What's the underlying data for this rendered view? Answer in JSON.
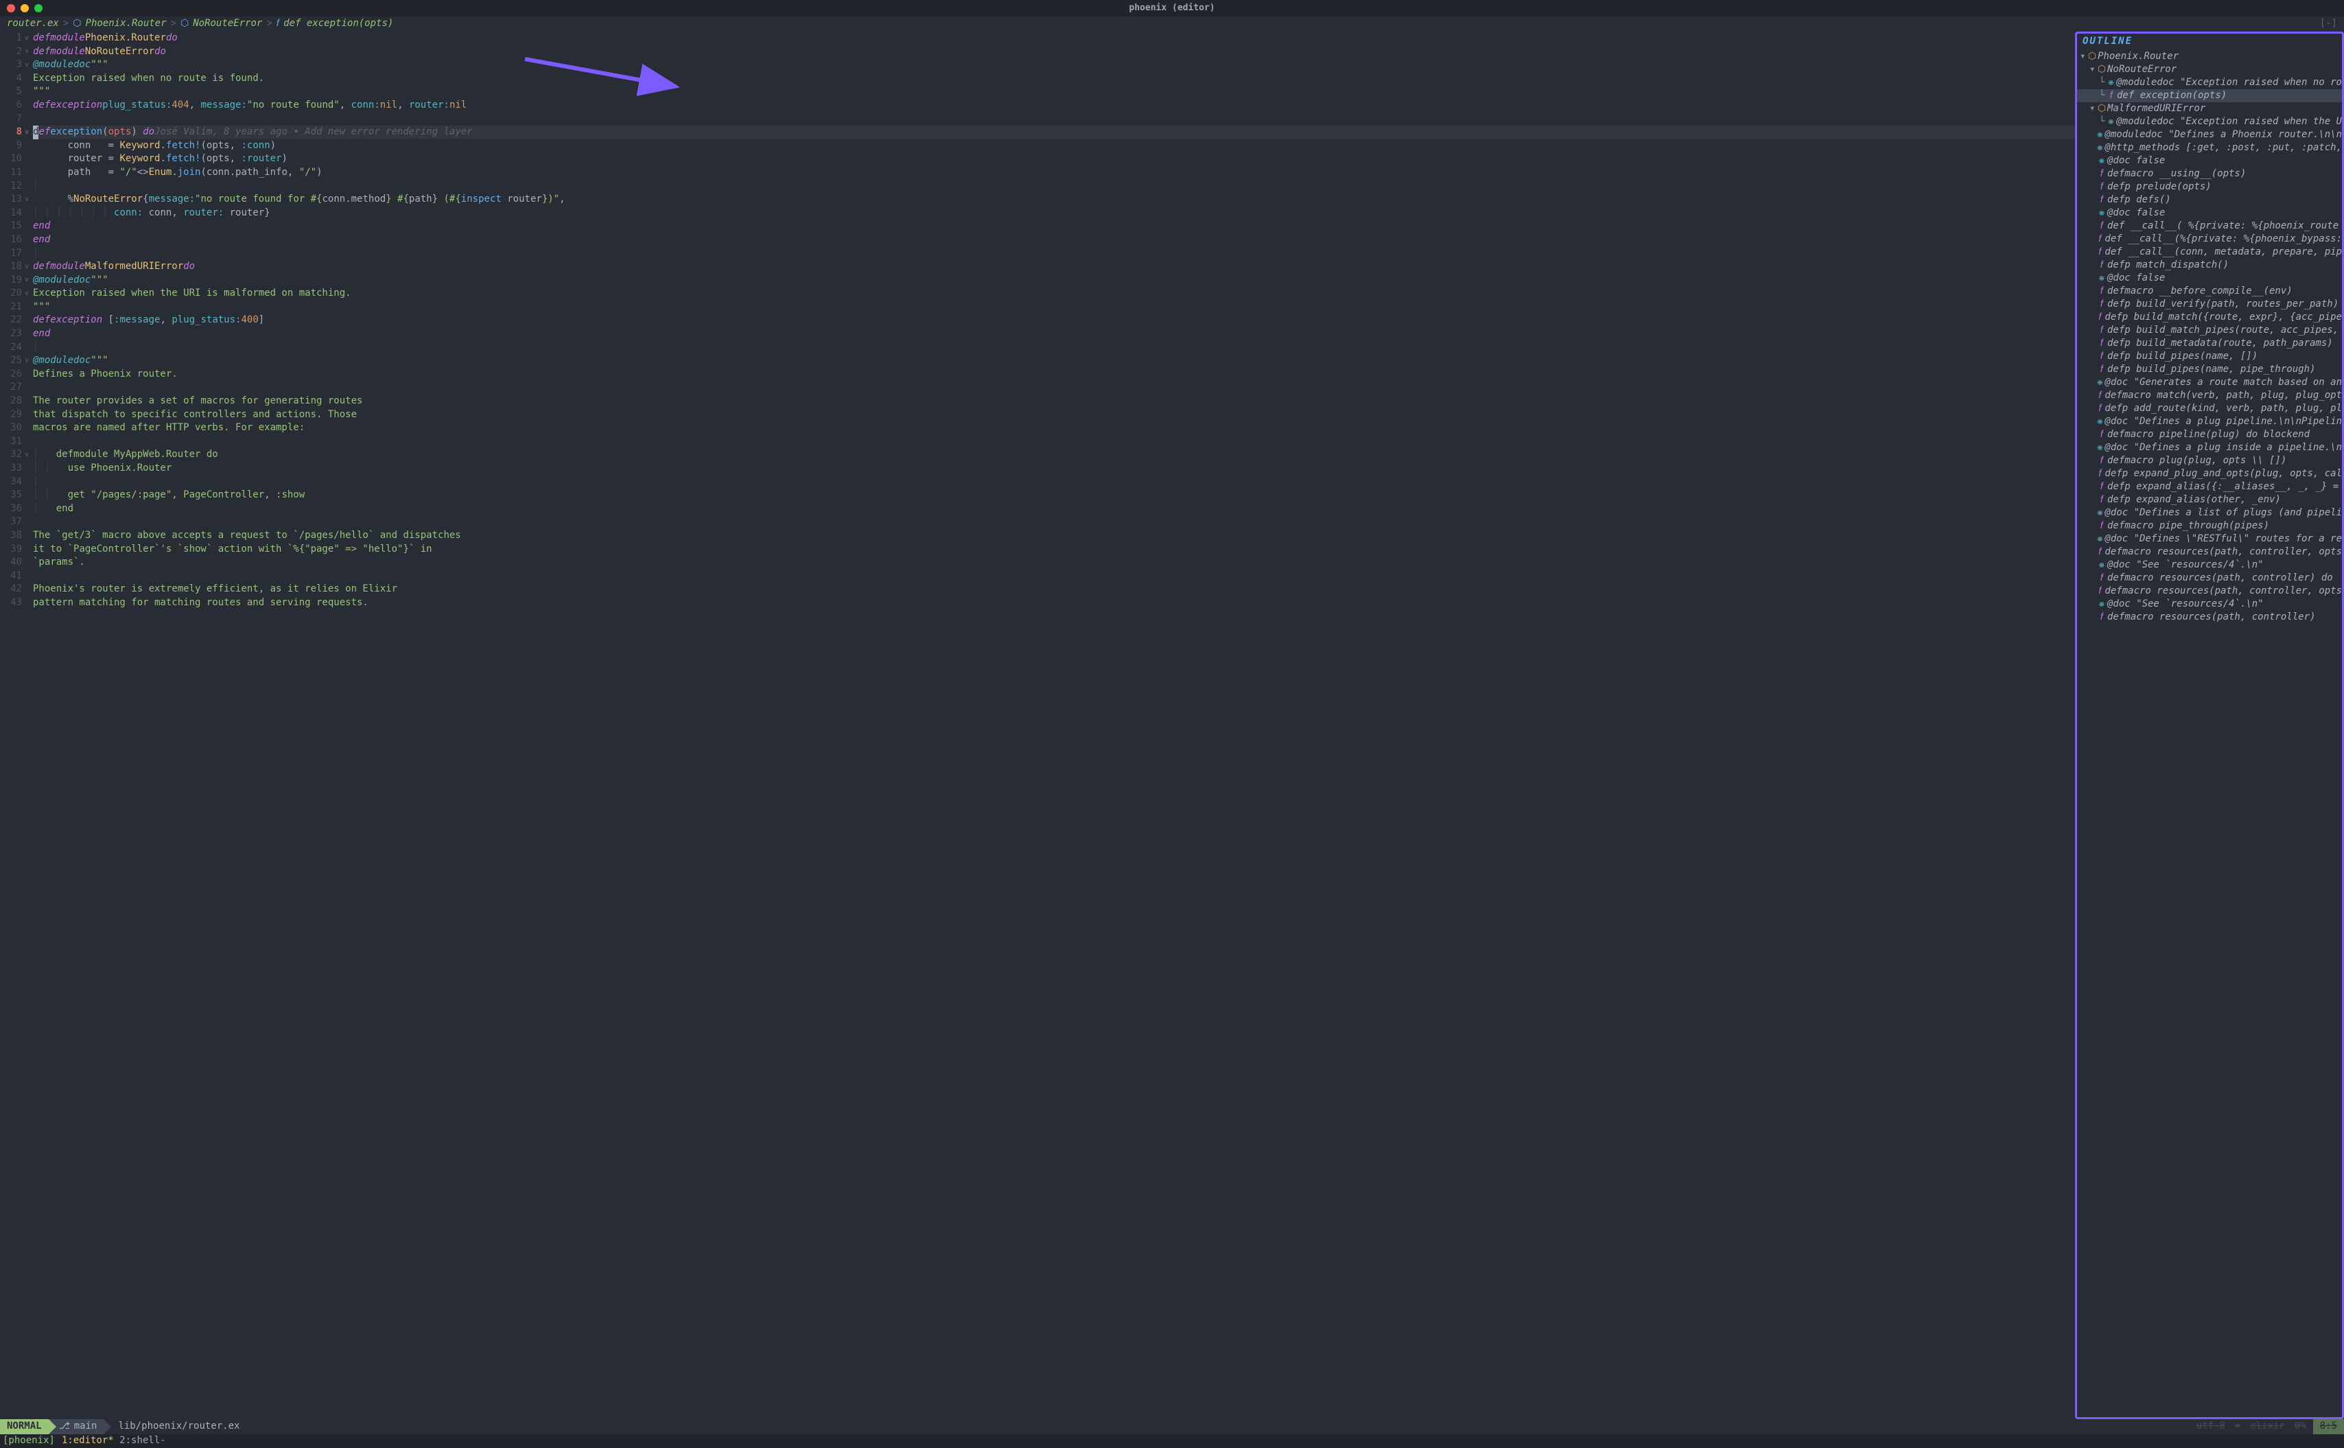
{
  "title": "phoenix (editor)",
  "breadcrumb": {
    "file": "router.ex",
    "segments": [
      {
        "icon": "⬡",
        "label": "Phoenix.Router"
      },
      {
        "icon": "⬡",
        "label": "NoRouteError"
      },
      {
        "icon": "𝑓",
        "label": "def exception(opts)"
      }
    ],
    "toggle": "[-]"
  },
  "editor": {
    "current_line": 8,
    "lines": [
      {
        "n": 1,
        "fold": "v",
        "html": "<span class='kw'>defmodule</span> <span class='mod'>Phoenix.Router</span> <span class='kw2'>do</span>"
      },
      {
        "n": 2,
        "fold": "v",
        "html": "  <span class='kw'>defmodule</span> <span class='mod'>NoRouteError</span> <span class='kw2'>do</span>"
      },
      {
        "n": 3,
        "fold": "v",
        "html": "    <span class='attr'>@moduledoc</span> <span class='str'>\"\"\"</span>"
      },
      {
        "n": 4,
        "fold": "",
        "html": "    <span class='str'>Exception raised when no route is found.</span>"
      },
      {
        "n": 5,
        "fold": "",
        "html": "    <span class='str'>\"\"\"</span>"
      },
      {
        "n": 6,
        "fold": "",
        "html": "    <span class='kw'>defexception</span> <span class='atom'>plug_status:</span> <span class='num'>404</span>, <span class='atom'>message:</span> <span class='str'>\"no route found\"</span>, <span class='atom'>conn:</span> <span class='num'>nil</span>, <span class='atom'>router:</span> <span class='num'>nil</span>"
      },
      {
        "n": 7,
        "fold": "",
        "html": ""
      },
      {
        "n": 8,
        "fold": "v",
        "html": "    <span class='cursor-box'>d</span><span class='kw' style='font-style:italic'>ef</span> <span class='fn'>exception</span>(<span class='param'>opts</span>) <span class='kw2'>do</span>    <span class='blame'>José Valim, 8 years ago • Add new error rendering layer</span>",
        "current": true
      },
      {
        "n": 9,
        "fold": "",
        "html": "      conn   = <span class='mod'>Keyword</span>.<span class='fn'>fetch!</span>(opts, <span class='atom'>:conn</span>)"
      },
      {
        "n": 10,
        "fold": "",
        "html": "      router = <span class='mod'>Keyword</span>.<span class='fn'>fetch!</span>(opts, <span class='atom'>:router</span>)"
      },
      {
        "n": 11,
        "fold": "",
        "html": "      path   = <span class='str'>\"/\"</span> <span class='op'>&lt;&gt;</span> <span class='mod'>Enum</span>.<span class='fn'>join</span>(conn.path_info, <span class='str'>\"/\"</span>)"
      },
      {
        "n": 12,
        "fold": "",
        "html": "      <span class='indent-guide'>│</span>"
      },
      {
        "n": 13,
        "fold": "v",
        "html": "      %<span class='mod'>NoRouteError</span>{<span class='atom'>message:</span> <span class='str'>\"no route found for #{</span>conn.method<span class='str'>} #{</span>path<span class='str'>} (#{</span><span class='fn'>inspect</span> router<span class='str'>})\"</span>,"
      },
      {
        "n": 14,
        "fold": "",
        "html": "      <span class='indent-guide'>│ │ │ │ │ │ │ </span><span class='atom'>conn:</span> conn, <span class='atom'>router:</span> router}"
      },
      {
        "n": 15,
        "fold": "",
        "html": "    <span class='kw2'>end</span>"
      },
      {
        "n": 16,
        "fold": "",
        "html": "  <span class='kw2'>end</span>"
      },
      {
        "n": 17,
        "fold": "",
        "html": "  <span class='indent-guide'>│</span>"
      },
      {
        "n": 18,
        "fold": "v",
        "html": "  <span class='kw'>defmodule</span> <span class='mod'>MalformedURIError</span> <span class='kw2'>do</span>"
      },
      {
        "n": 19,
        "fold": "v",
        "html": "    <span class='attr'>@moduledoc</span> <span class='str'>\"\"\"</span>"
      },
      {
        "n": 20,
        "fold": "v",
        "html": "    <span class='str'>Exception raised when the URI is malformed on matching.</span>"
      },
      {
        "n": 21,
        "fold": "",
        "html": "    <span class='str'>\"\"\"</span>"
      },
      {
        "n": 22,
        "fold": "",
        "html": "    <span class='kw'>defexception</span> [<span class='atom'>:message</span>, <span class='atom'>plug_status:</span> <span class='num'>400</span>]"
      },
      {
        "n": 23,
        "fold": "",
        "html": "  <span class='kw2'>end</span>"
      },
      {
        "n": 24,
        "fold": "",
        "html": "  <span class='indent-guide'>│</span>"
      },
      {
        "n": 25,
        "fold": "v",
        "html": "  <span class='attr'>@moduledoc</span> <span class='str'>\"\"\"</span>"
      },
      {
        "n": 26,
        "fold": "",
        "html": "  <span class='str'>Defines a Phoenix router.</span>"
      },
      {
        "n": 27,
        "fold": "",
        "html": ""
      },
      {
        "n": 28,
        "fold": "",
        "html": "  <span class='str'>The router provides a set of macros for generating routes</span>"
      },
      {
        "n": 29,
        "fold": "",
        "html": "  <span class='str'>that dispatch to specific controllers and actions. Those</span>"
      },
      {
        "n": 30,
        "fold": "",
        "html": "  <span class='str'>macros are named after HTTP verbs. For example:</span>"
      },
      {
        "n": 31,
        "fold": "",
        "html": ""
      },
      {
        "n": 32,
        "fold": "v",
        "html": "  <span class='indent-guide'>│ </span><span class='str'>  defmodule MyAppWeb.Router do</span>"
      },
      {
        "n": 33,
        "fold": "",
        "html": "  <span class='indent-guide'>│ │ </span><span class='str'>  use Phoenix.Router</span>"
      },
      {
        "n": 34,
        "fold": "",
        "html": "  <span class='indent-guide'>│</span>"
      },
      {
        "n": 35,
        "fold": "",
        "html": "  <span class='indent-guide'>│ │ </span><span class='str'>  get \"/pages/:page\", PageController, :show</span>"
      },
      {
        "n": 36,
        "fold": "",
        "html": "  <span class='indent-guide'>│ </span><span class='str'>  end</span>"
      },
      {
        "n": 37,
        "fold": "",
        "html": ""
      },
      {
        "n": 38,
        "fold": "",
        "html": "  <span class='str'>The `get/3` macro above accepts a request to `/pages/hello` and dispatches</span>"
      },
      {
        "n": 39,
        "fold": "",
        "html": "  <span class='str'>it to `PageController`'s `show` action with `%{\"page\" =&gt; \"hello\"}` in</span>"
      },
      {
        "n": 40,
        "fold": "",
        "html": "  <span class='str'>`params`.</span>"
      },
      {
        "n": 41,
        "fold": "",
        "html": ""
      },
      {
        "n": 42,
        "fold": "",
        "html": "  <span class='str'>Phoenix's router is extremely efficient, as it relies on Elixir</span>"
      },
      {
        "n": 43,
        "fold": "",
        "html": "  <span class='str'>pattern matching for matching routes and serving requests.</span>"
      }
    ]
  },
  "outline": {
    "header": "OUTLINE",
    "items": [
      {
        "indent": 0,
        "twisty": "v",
        "icon": "⬡",
        "iconClass": "oi-module",
        "label": "Phoenix.Router"
      },
      {
        "indent": 1,
        "twisty": "v",
        "icon": "⬡",
        "iconClass": "oi-module",
        "label": "NoRouteError"
      },
      {
        "indent": 2,
        "twisty": "└",
        "icon": "❋",
        "iconClass": "oi-attr",
        "label": "@moduledoc \"Exception raised when no ro"
      },
      {
        "indent": 2,
        "twisty": "└",
        "icon": "𝑓",
        "iconClass": "oi-func",
        "label": "def exception(opts)",
        "selected": true
      },
      {
        "indent": 1,
        "twisty": "v",
        "icon": "⬡",
        "iconClass": "oi-module",
        "label": "MalformedURIError"
      },
      {
        "indent": 2,
        "twisty": "└",
        "icon": "❋",
        "iconClass": "oi-attr",
        "label": "@moduledoc \"Exception raised when the U"
      },
      {
        "indent": 1,
        "twisty": "",
        "icon": "❋",
        "iconClass": "oi-attr",
        "label": "@moduledoc \"Defines a Phoenix router.\\n\\n"
      },
      {
        "indent": 1,
        "twisty": "",
        "icon": "❋",
        "iconClass": "oi-attr",
        "label": "@http_methods [:get, :post, :put, :patch,"
      },
      {
        "indent": 1,
        "twisty": "",
        "icon": "❋",
        "iconClass": "oi-attr",
        "label": "@doc false"
      },
      {
        "indent": 1,
        "twisty": "",
        "icon": "𝑓",
        "iconClass": "oi-func",
        "label": "defmacro __using__(opts)"
      },
      {
        "indent": 1,
        "twisty": "",
        "icon": "𝑓",
        "iconClass": "oi-func",
        "label": "defp prelude(opts)"
      },
      {
        "indent": 1,
        "twisty": "",
        "icon": "𝑓",
        "iconClass": "oi-func",
        "label": "defp defs()"
      },
      {
        "indent": 1,
        "twisty": "",
        "icon": "❋",
        "iconClass": "oi-attr",
        "label": "@doc false"
      },
      {
        "indent": 1,
        "twisty": "",
        "icon": "𝑓",
        "iconClass": "oi-func",
        "label": "def __call__(  %{private: %{phoenix_route"
      },
      {
        "indent": 1,
        "twisty": "",
        "icon": "𝑓",
        "iconClass": "oi-func",
        "label": "def __call__(%{private: %{phoenix_bypass:"
      },
      {
        "indent": 1,
        "twisty": "",
        "icon": "𝑓",
        "iconClass": "oi-func",
        "label": "def __call__(conn, metadata, prepare, pip"
      },
      {
        "indent": 1,
        "twisty": "",
        "icon": "𝑓",
        "iconClass": "oi-func",
        "label": "defp match_dispatch()"
      },
      {
        "indent": 1,
        "twisty": "",
        "icon": "❋",
        "iconClass": "oi-attr",
        "label": "@doc false"
      },
      {
        "indent": 1,
        "twisty": "",
        "icon": "𝑓",
        "iconClass": "oi-func",
        "label": "defmacro __before_compile__(env)"
      },
      {
        "indent": 1,
        "twisty": "",
        "icon": "𝑓",
        "iconClass": "oi-func",
        "label": "defp build_verify(path, routes_per_path)"
      },
      {
        "indent": 1,
        "twisty": "",
        "icon": "𝑓",
        "iconClass": "oi-func",
        "label": "defp build_match({route, expr}, {acc_pipe"
      },
      {
        "indent": 1,
        "twisty": "",
        "icon": "𝑓",
        "iconClass": "oi-func",
        "label": "defp build_match_pipes(route, acc_pipes,"
      },
      {
        "indent": 1,
        "twisty": "",
        "icon": "𝑓",
        "iconClass": "oi-func",
        "label": "defp build_metadata(route, path_params)"
      },
      {
        "indent": 1,
        "twisty": "",
        "icon": "𝑓",
        "iconClass": "oi-func",
        "label": "defp build_pipes(name, [])"
      },
      {
        "indent": 1,
        "twisty": "",
        "icon": "𝑓",
        "iconClass": "oi-func",
        "label": "defp build_pipes(name, pipe_through)"
      },
      {
        "indent": 1,
        "twisty": "",
        "icon": "❋",
        "iconClass": "oi-attr",
        "label": "@doc \"Generates a route match based on an"
      },
      {
        "indent": 1,
        "twisty": "",
        "icon": "𝑓",
        "iconClass": "oi-func",
        "label": "defmacro match(verb, path, plug, plug_opt"
      },
      {
        "indent": 1,
        "twisty": "",
        "icon": "𝑓",
        "iconClass": "oi-func",
        "label": "defp add_route(kind, verb, path, plug, pl"
      },
      {
        "indent": 1,
        "twisty": "",
        "icon": "❋",
        "iconClass": "oi-attr",
        "label": "@doc \"Defines a plug pipeline.\\n\\nPipelin"
      },
      {
        "indent": 1,
        "twisty": "",
        "icon": "𝑓",
        "iconClass": "oi-func",
        "label": "defmacro pipeline(plug) do  blockend"
      },
      {
        "indent": 1,
        "twisty": "",
        "icon": "❋",
        "iconClass": "oi-attr",
        "label": "@doc \"Defines a plug inside a pipeline.\\n"
      },
      {
        "indent": 1,
        "twisty": "",
        "icon": "𝑓",
        "iconClass": "oi-func",
        "label": "defmacro plug(plug, opts \\\\ [])"
      },
      {
        "indent": 1,
        "twisty": "",
        "icon": "𝑓",
        "iconClass": "oi-func",
        "label": "defp expand_plug_and_opts(plug, opts, cal"
      },
      {
        "indent": 1,
        "twisty": "",
        "icon": "𝑓",
        "iconClass": "oi-func",
        "label": "defp expand_alias({:__aliases__, _, _} ="
      },
      {
        "indent": 1,
        "twisty": "",
        "icon": "𝑓",
        "iconClass": "oi-func",
        "label": "defp expand_alias(other, _env)"
      },
      {
        "indent": 1,
        "twisty": "",
        "icon": "❋",
        "iconClass": "oi-attr",
        "label": "@doc \"Defines a list of plugs (and pipeli"
      },
      {
        "indent": 1,
        "twisty": "",
        "icon": "𝑓",
        "iconClass": "oi-func",
        "label": "defmacro pipe_through(pipes)"
      },
      {
        "indent": 1,
        "twisty": "",
        "icon": "❋",
        "iconClass": "oi-attr",
        "label": "@doc \"Defines \\\"RESTful\\\" routes for a re"
      },
      {
        "indent": 1,
        "twisty": "",
        "icon": "𝑓",
        "iconClass": "oi-func",
        "label": "defmacro resources(path, controller, opts"
      },
      {
        "indent": 1,
        "twisty": "",
        "icon": "❋",
        "iconClass": "oi-attr",
        "label": "@doc \"See `resources/4`.\\n\""
      },
      {
        "indent": 1,
        "twisty": "",
        "icon": "𝑓",
        "iconClass": "oi-func",
        "label": "defmacro resources(path, controller) do"
      },
      {
        "indent": 1,
        "twisty": "",
        "icon": "𝑓",
        "iconClass": "oi-func",
        "label": "defmacro resources(path, controller, opts"
      },
      {
        "indent": 1,
        "twisty": "",
        "icon": "❋",
        "iconClass": "oi-attr",
        "label": "@doc \"See `resources/4`.\\n\""
      },
      {
        "indent": 1,
        "twisty": "",
        "icon": "𝑓",
        "iconClass": "oi-func",
        "label": "defmacro resources(path, controller)"
      }
    ]
  },
  "status": {
    "mode": "NORMAL",
    "branch": "main",
    "file": "lib/phoenix/router.ex",
    "encoding": "utf-8",
    "lang": "elixir",
    "percent": "0%",
    "pos": "8:5"
  },
  "tmux": {
    "session": "[phoenix]",
    "windows": [
      {
        "index": "1",
        "name": "editor*",
        "active": true
      },
      {
        "index": "2",
        "name": "shell-",
        "active": false
      }
    ]
  }
}
